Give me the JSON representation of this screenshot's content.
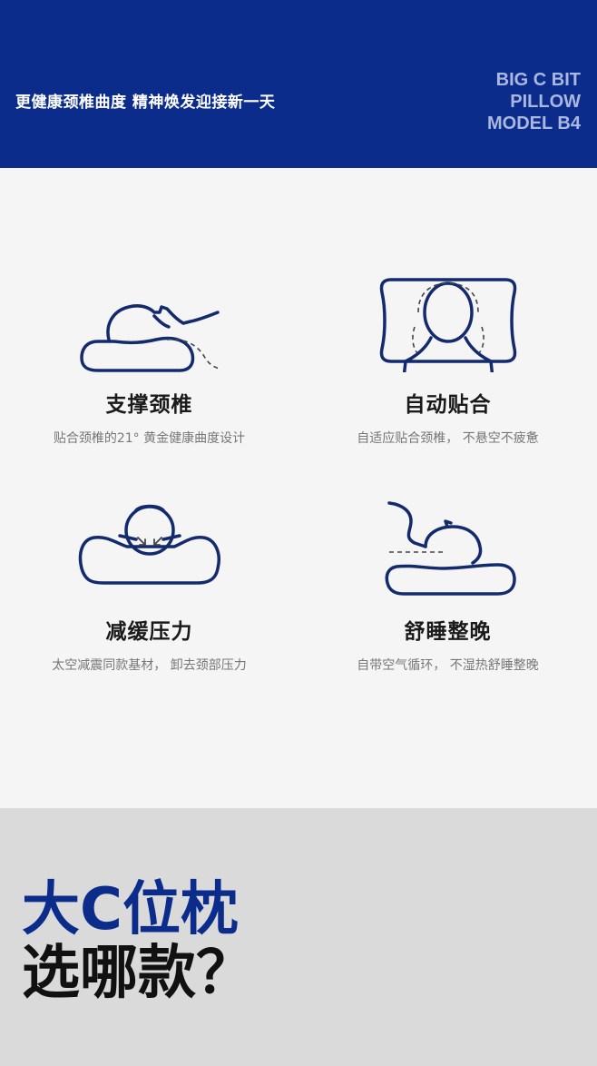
{
  "header": {
    "slogan": "更健康颈椎曲度 精神焕发迎接新一天",
    "brand_line1": "BIG C BIT",
    "brand_line2": "PILLOW",
    "brand_line3": "MODEL B4",
    "background_color": "#0c2c8c"
  },
  "features": [
    {
      "icon": "neck-support-icon",
      "title": "支撑颈椎",
      "desc": "贴合颈椎的21° 黄金健康曲度设计"
    },
    {
      "icon": "auto-fit-head-icon",
      "title": "自动贴合",
      "desc": "自适应贴合颈椎，  不悬空不疲惫"
    },
    {
      "icon": "pressure-relief-icon",
      "title": "减缓压力",
      "desc": "太空减震同款基材，  卸去颈部压力"
    },
    {
      "icon": "comfort-sleep-icon",
      "title": "舒睡整晚",
      "desc": "自带空气循环，  不湿热舒睡整晚"
    }
  ],
  "bottom": {
    "line1": "大C位枕",
    "line2": "选哪款？",
    "accent_color": "#0c2c8c"
  }
}
